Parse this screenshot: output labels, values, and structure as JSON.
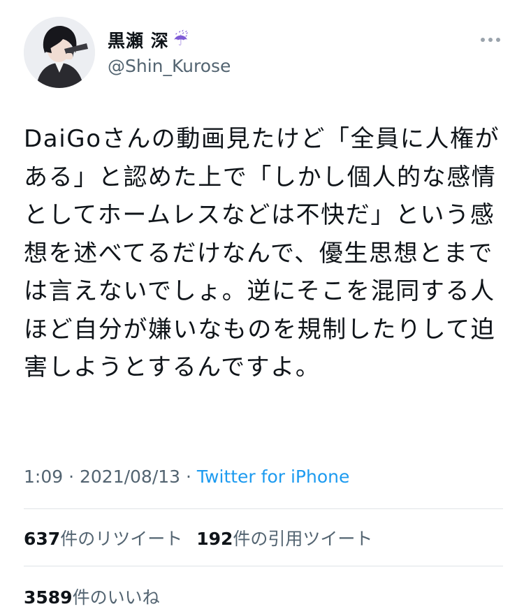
{
  "tweet": {
    "display_name": "黒瀬 深",
    "name_emoji": "☔",
    "handle": "@Shin_Kurose",
    "more_icon": "more-horizontal-icon",
    "text": "DaiGoさんの動画見たけど「全員に人権がある」と認めた上で「しかし個人的な感情としてホームレスなどは不快だ」という感想を述べてるだけなんで、優生思想とまでは言えないでしょ。逆にそこを混同する人ほど自分が嫌いなものを規制したりして迫害しようとするんですよ。",
    "time": "1:09",
    "separator1": " · ",
    "date": "2021/08/13",
    "separator2": " · ",
    "client": "Twitter for iPhone"
  },
  "stats": {
    "retweets_count": "637",
    "retweets_label": "件のリツイート",
    "quotes_count": "192",
    "quotes_label": "件の引用ツイート",
    "likes_count": "3589",
    "likes_label": "件のいいね"
  },
  "colors": {
    "link": "#1d9bf0",
    "secondary": "#536471",
    "text": "#0f1419"
  }
}
